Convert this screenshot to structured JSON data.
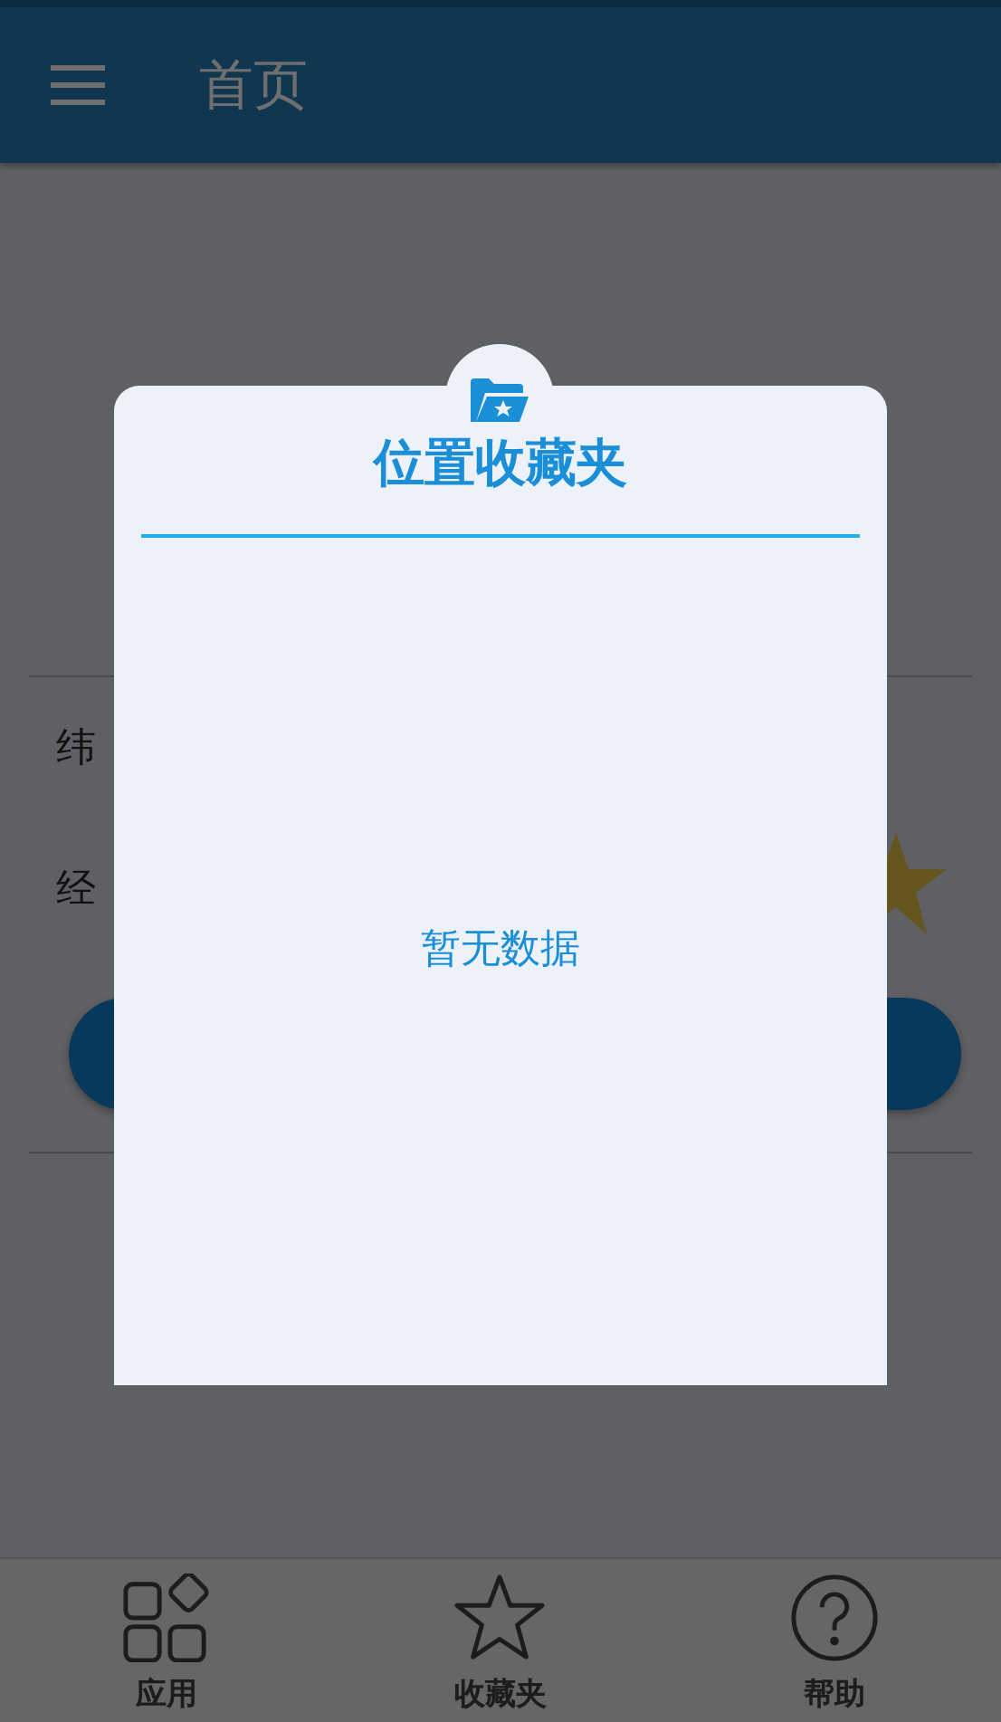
{
  "header": {
    "title": "首页"
  },
  "page": {
    "rows": [
      {
        "label": "纬"
      },
      {
        "label": "经"
      }
    ]
  },
  "dialog": {
    "title": "位置收藏夹",
    "empty_text": "暂无数据"
  },
  "bottom_nav": [
    {
      "label": "应用",
      "selected": false
    },
    {
      "label": "收藏夹",
      "selected": false
    },
    {
      "label": "帮助",
      "selected": false
    }
  ]
}
